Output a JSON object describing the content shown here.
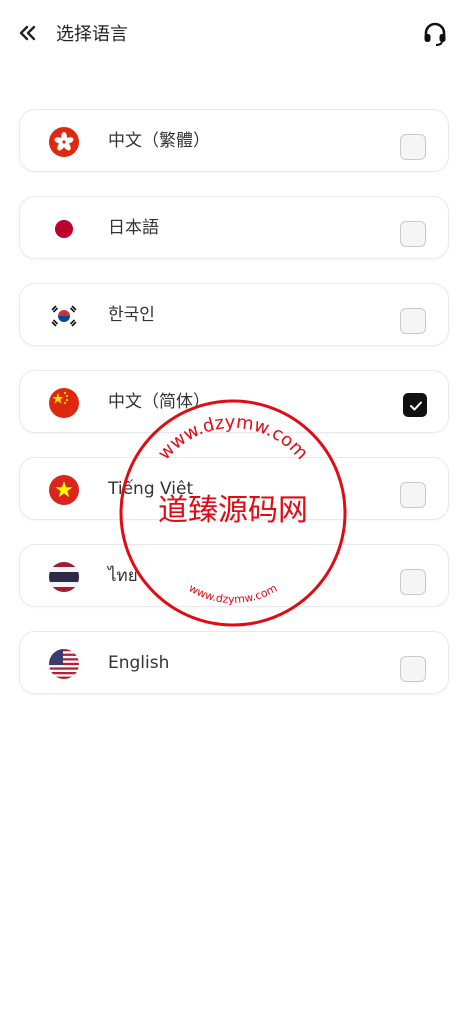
{
  "header": {
    "title": "选择语言",
    "back_icon": "double-chevron-left-icon",
    "support_icon": "headset-icon"
  },
  "languages": [
    {
      "label": "中文（繁體）",
      "flag": "hong-kong-flag",
      "checked": false
    },
    {
      "label": "日本語",
      "flag": "japan-flag",
      "checked": false
    },
    {
      "label": "한국인",
      "flag": "korea-flag",
      "checked": false
    },
    {
      "label": "中文（简体）",
      "flag": "china-flag",
      "checked": true
    },
    {
      "label": "Tiếng Việt",
      "flag": "vietnam-flag",
      "checked": false
    },
    {
      "label": "ไทย",
      "flag": "thailand-flag",
      "checked": false
    },
    {
      "label": "English",
      "flag": "usa-flag",
      "checked": false
    }
  ],
  "watermark": {
    "text": "道臻源码网",
    "ring_text": "www.dzymw.com",
    "color": "#e10b14"
  }
}
